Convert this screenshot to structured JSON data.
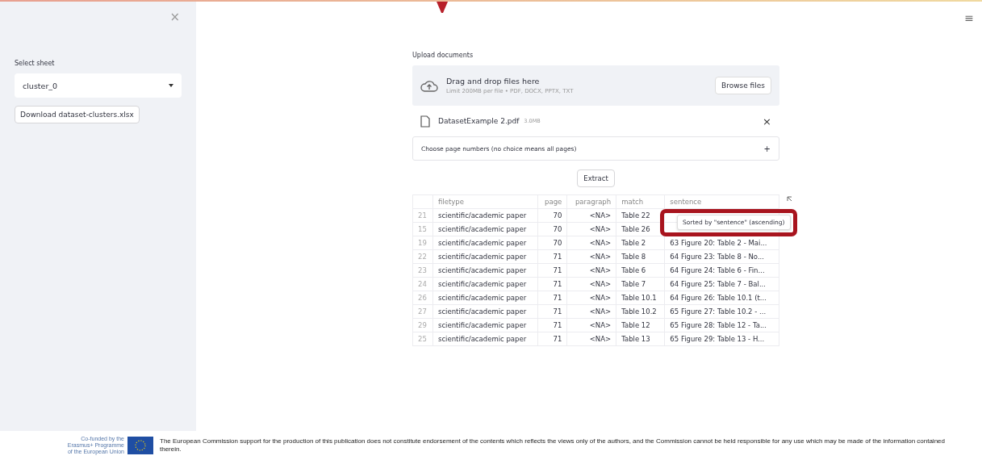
{
  "sidebar": {
    "close_icon": "×",
    "select": {
      "label": "Select sheet",
      "value": "cluster_0"
    },
    "download_button": "Download dataset-clusters.xlsx"
  },
  "menu_icon": "≡",
  "upload": {
    "label": "Upload documents",
    "title": "Drag and drop files here",
    "hint": "Limit 200MB per file • PDF, DOCX, PPTX, TXT",
    "browse_button": "Browse files"
  },
  "file": {
    "name": "DatasetExample 2.pdf",
    "size": "3.0MB",
    "remove": "×"
  },
  "page_select": {
    "label": "Choose page numbers (no choice means all pages)",
    "expand": "+"
  },
  "extract_button": "Extract",
  "table": {
    "columns": [
      "filetype",
      "page",
      "paragraph",
      "match",
      "sentence"
    ],
    "rows": [
      {
        "index": "21",
        "filetype": "scientific/academic paper",
        "page": "70",
        "paragraph": "<NA>",
        "match": "Table 22"
      },
      {
        "index": "15",
        "filetype": "scientific/academic paper",
        "page": "70",
        "paragraph": "<NA>",
        "match": "Table 26"
      },
      {
        "index": "19",
        "filetype": "scientific/academic paper",
        "page": "70",
        "paragraph": "<NA>",
        "match": "Table 2",
        "sentence": "63 Figure 20: Table 2 - Mai..."
      },
      {
        "index": "22",
        "filetype": "scientific/academic paper",
        "page": "71",
        "paragraph": "<NA>",
        "match": "Table 8",
        "sentence": "64 Figure 23: Table 8 - No..."
      },
      {
        "index": "23",
        "filetype": "scientific/academic paper",
        "page": "71",
        "paragraph": "<NA>",
        "match": "Table 6",
        "sentence": "64 Figure 24: Table 6 - Fin..."
      },
      {
        "index": "24",
        "filetype": "scientific/academic paper",
        "page": "71",
        "paragraph": "<NA>",
        "match": "Table 7",
        "sentence": "64 Figure 25: Table 7 - Bal..."
      },
      {
        "index": "26",
        "filetype": "scientific/academic paper",
        "page": "71",
        "paragraph": "<NA>",
        "match": "Table 10.1",
        "sentence": "64 Figure 26: Table 10.1 (t..."
      },
      {
        "index": "27",
        "filetype": "scientific/academic paper",
        "page": "71",
        "paragraph": "<NA>",
        "match": "Table 10.2",
        "sentence": "65 Figure 27: Table 10.2 - ..."
      },
      {
        "index": "29",
        "filetype": "scientific/academic paper",
        "page": "71",
        "paragraph": "<NA>",
        "match": "Table 12",
        "sentence": "65 Figure 28: Table 12 - Ta..."
      },
      {
        "index": "25",
        "filetype": "scientific/academic paper",
        "page": "71",
        "paragraph": "<NA>",
        "match": "Table 13",
        "sentence": "65 Figure 29: Table 13 - H..."
      }
    ],
    "tooltip": "Sorted by \"sentence\" (ascending)"
  },
  "footer": {
    "logo_lines": [
      "Co-funded by the",
      "Erasmus+ Programme",
      "of the European Union"
    ],
    "disclaimer": "The European Commission support for the production of this publication does not constitute endorsement of the contents which reflects the views only of the authors, and the Commission cannot be held responsible for any use which may be made of the information contained therein."
  }
}
